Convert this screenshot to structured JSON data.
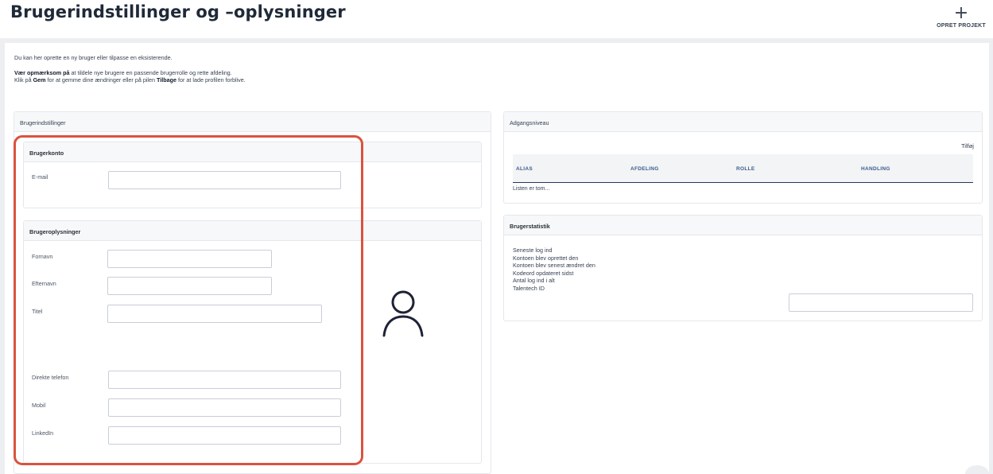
{
  "header": {
    "title": "Brugerindstillinger og –oplysninger",
    "create_project_label": "OPRET PROJEKT",
    "plus_icon": "+"
  },
  "intro": {
    "line1": "Du kan her oprette en ny bruger eller tilpasse en eksisterende.",
    "line2_bold": "Vær opmærksom på",
    "line2_rest": " at tildele nye brugere en passende brugerrolle og rette afdeling.",
    "line3_pre": "Klik på ",
    "line3_gem": "Gem",
    "line3_mid": " for at gemme dine ændringer eller på pilen ",
    "line3_tilbage": "Tilbage",
    "line3_end": " for at lade profilen forblive."
  },
  "user_settings": {
    "title": "Brugerindstillinger",
    "account": {
      "title": "Brugerkonto",
      "email_label": "E-mail",
      "email_value": ""
    },
    "info": {
      "title": "Brugeroplysninger",
      "first_name_label": "Fornavn",
      "last_name_label": "Efternavn",
      "title_label": "Titel",
      "direct_phone_label": "Direkte telefon",
      "mobile_label": "Mobil",
      "linkedin_label": "LinkedIn",
      "first_name_value": "",
      "last_name_value": "",
      "title_value": "",
      "direct_phone_value": "",
      "mobile_value": "",
      "linkedin_value": ""
    }
  },
  "access_level": {
    "title": "Adgangsniveau",
    "add_label": "Tilføj",
    "columns": [
      "ALIAS",
      "AFDELING",
      "ROLLE",
      "HANDLING"
    ],
    "empty_text": "Listen er tom..."
  },
  "user_stats": {
    "title": "Brugerstatistik",
    "rows": [
      "Seneste log ind",
      "Kontoen blev oprettet den",
      "Kontoen blev senest ændret den",
      "Kodeord opdateret sidst",
      "Antal log ind i alt",
      "Talentech ID"
    ],
    "talentech_id_value": ""
  },
  "colors": {
    "highlight": "#d9533f",
    "table_header_text": "#3b5b8c",
    "background": "#eceef1"
  }
}
